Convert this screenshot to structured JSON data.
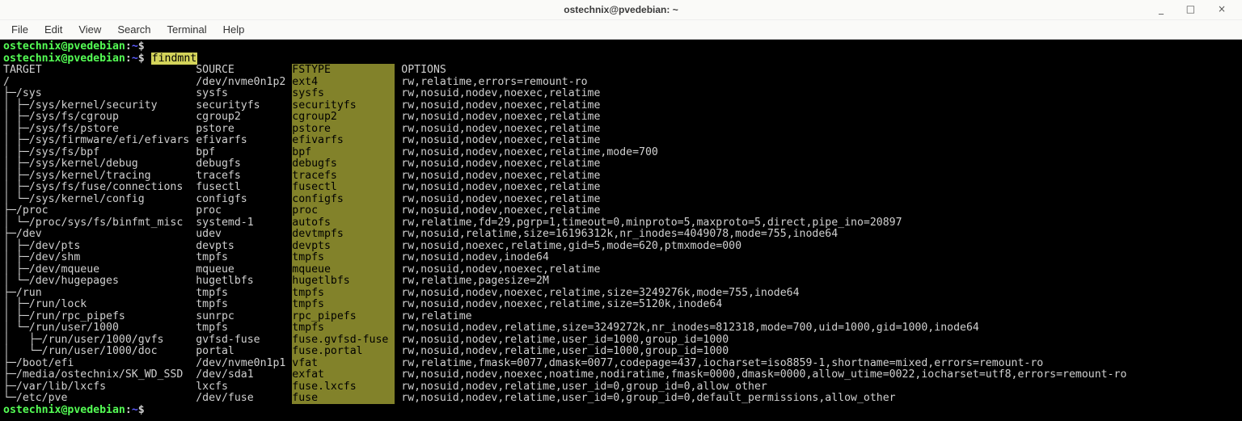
{
  "window": {
    "title": "ostechnix@pvedebian: ~"
  },
  "menubar": [
    "File",
    "Edit",
    "View",
    "Search",
    "Terminal",
    "Help"
  ],
  "prompts": {
    "user_host": "ostechnix@pvedebian",
    "colon": ":",
    "path": "~",
    "dollar": "$"
  },
  "command": "findmnt",
  "headers": {
    "target": "TARGET",
    "source": "SOURCE",
    "fstype": "FSTYPE",
    "options": "OPTIONS"
  },
  "rows": [
    {
      "depth": 0,
      "last": false,
      "target": "/",
      "source": "/dev/nvme0n1p2",
      "fstype": "ext4",
      "options": "rw,relatime,errors=remount-ro"
    },
    {
      "depth": 1,
      "ancestors": [
        false
      ],
      "last": false,
      "target": "/sys",
      "source": "sysfs",
      "fstype": "sysfs",
      "options": "rw,nosuid,nodev,noexec,relatime"
    },
    {
      "depth": 2,
      "ancestors": [
        false,
        false
      ],
      "last": false,
      "target": "/sys/kernel/security",
      "source": "securityfs",
      "fstype": "securityfs",
      "options": "rw,nosuid,nodev,noexec,relatime"
    },
    {
      "depth": 2,
      "ancestors": [
        false,
        false
      ],
      "last": false,
      "target": "/sys/fs/cgroup",
      "source": "cgroup2",
      "fstype": "cgroup2",
      "options": "rw,nosuid,nodev,noexec,relatime"
    },
    {
      "depth": 2,
      "ancestors": [
        false,
        false
      ],
      "last": false,
      "target": "/sys/fs/pstore",
      "source": "pstore",
      "fstype": "pstore",
      "options": "rw,nosuid,nodev,noexec,relatime"
    },
    {
      "depth": 2,
      "ancestors": [
        false,
        false
      ],
      "last": false,
      "target": "/sys/firmware/efi/efivars",
      "source": "efivarfs",
      "fstype": "efivarfs",
      "options": "rw,nosuid,nodev,noexec,relatime"
    },
    {
      "depth": 2,
      "ancestors": [
        false,
        false
      ],
      "last": false,
      "target": "/sys/fs/bpf",
      "source": "bpf",
      "fstype": "bpf",
      "options": "rw,nosuid,nodev,noexec,relatime,mode=700"
    },
    {
      "depth": 2,
      "ancestors": [
        false,
        false
      ],
      "last": false,
      "target": "/sys/kernel/debug",
      "source": "debugfs",
      "fstype": "debugfs",
      "options": "rw,nosuid,nodev,noexec,relatime"
    },
    {
      "depth": 2,
      "ancestors": [
        false,
        false
      ],
      "last": false,
      "target": "/sys/kernel/tracing",
      "source": "tracefs",
      "fstype": "tracefs",
      "options": "rw,nosuid,nodev,noexec,relatime"
    },
    {
      "depth": 2,
      "ancestors": [
        false,
        false
      ],
      "last": false,
      "target": "/sys/fs/fuse/connections",
      "source": "fusectl",
      "fstype": "fusectl",
      "options": "rw,nosuid,nodev,noexec,relatime"
    },
    {
      "depth": 2,
      "ancestors": [
        false,
        false
      ],
      "last": true,
      "target": "/sys/kernel/config",
      "source": "configfs",
      "fstype": "configfs",
      "options": "rw,nosuid,nodev,noexec,relatime"
    },
    {
      "depth": 1,
      "ancestors": [
        false
      ],
      "last": false,
      "target": "/proc",
      "source": "proc",
      "fstype": "proc",
      "options": "rw,nosuid,nodev,noexec,relatime"
    },
    {
      "depth": 2,
      "ancestors": [
        false,
        false
      ],
      "last": true,
      "target": "/proc/sys/fs/binfmt_misc",
      "source": "systemd-1",
      "fstype": "autofs",
      "options": "rw,relatime,fd=29,pgrp=1,timeout=0,minproto=5,maxproto=5,direct,pipe_ino=20897"
    },
    {
      "depth": 1,
      "ancestors": [
        false
      ],
      "last": false,
      "target": "/dev",
      "source": "udev",
      "fstype": "devtmpfs",
      "options": "rw,nosuid,relatime,size=16196312k,nr_inodes=4049078,mode=755,inode64"
    },
    {
      "depth": 2,
      "ancestors": [
        false,
        false
      ],
      "last": false,
      "target": "/dev/pts",
      "source": "devpts",
      "fstype": "devpts",
      "options": "rw,nosuid,noexec,relatime,gid=5,mode=620,ptmxmode=000"
    },
    {
      "depth": 2,
      "ancestors": [
        false,
        false
      ],
      "last": false,
      "target": "/dev/shm",
      "source": "tmpfs",
      "fstype": "tmpfs",
      "options": "rw,nosuid,nodev,inode64"
    },
    {
      "depth": 2,
      "ancestors": [
        false,
        false
      ],
      "last": false,
      "target": "/dev/mqueue",
      "source": "mqueue",
      "fstype": "mqueue",
      "options": "rw,nosuid,nodev,noexec,relatime"
    },
    {
      "depth": 2,
      "ancestors": [
        false,
        false
      ],
      "last": true,
      "target": "/dev/hugepages",
      "source": "hugetlbfs",
      "fstype": "hugetlbfs",
      "options": "rw,relatime,pagesize=2M"
    },
    {
      "depth": 1,
      "ancestors": [
        false
      ],
      "last": false,
      "target": "/run",
      "source": "tmpfs",
      "fstype": "tmpfs",
      "options": "rw,nosuid,nodev,noexec,relatime,size=3249276k,mode=755,inode64"
    },
    {
      "depth": 2,
      "ancestors": [
        false,
        false
      ],
      "last": false,
      "target": "/run/lock",
      "source": "tmpfs",
      "fstype": "tmpfs",
      "options": "rw,nosuid,nodev,noexec,relatime,size=5120k,inode64"
    },
    {
      "depth": 2,
      "ancestors": [
        false,
        false
      ],
      "last": false,
      "target": "/run/rpc_pipefs",
      "source": "sunrpc",
      "fstype": "rpc_pipefs",
      "options": "rw,relatime"
    },
    {
      "depth": 2,
      "ancestors": [
        false,
        false
      ],
      "last": true,
      "target": "/run/user/1000",
      "source": "tmpfs",
      "fstype": "tmpfs",
      "options": "rw,nosuid,nodev,relatime,size=3249272k,nr_inodes=812318,mode=700,uid=1000,gid=1000,inode64"
    },
    {
      "depth": 3,
      "ancestors": [
        false,
        false,
        true
      ],
      "last": false,
      "target": "/run/user/1000/gvfs",
      "source": "gvfsd-fuse",
      "fstype": "fuse.gvfsd-fuse",
      "options": "rw,nosuid,nodev,relatime,user_id=1000,group_id=1000"
    },
    {
      "depth": 3,
      "ancestors": [
        false,
        false,
        true
      ],
      "last": true,
      "target": "/run/user/1000/doc",
      "source": "portal",
      "fstype": "fuse.portal",
      "options": "rw,nosuid,nodev,relatime,user_id=1000,group_id=1000"
    },
    {
      "depth": 1,
      "ancestors": [
        false
      ],
      "last": false,
      "target": "/boot/efi",
      "source": "/dev/nvme0n1p1",
      "fstype": "vfat",
      "options": "rw,relatime,fmask=0077,dmask=0077,codepage=437,iocharset=iso8859-1,shortname=mixed,errors=remount-ro"
    },
    {
      "depth": 1,
      "ancestors": [
        false
      ],
      "last": false,
      "target": "/media/ostechnix/SK_WD_SSD",
      "source": "/dev/sda1",
      "fstype": "exfat",
      "options": "rw,nosuid,nodev,noexec,noatime,nodiratime,fmask=0000,dmask=0000,allow_utime=0022,iocharset=utf8,errors=remount-ro"
    },
    {
      "depth": 1,
      "ancestors": [
        false
      ],
      "last": false,
      "target": "/var/lib/lxcfs",
      "source": "lxcfs",
      "fstype": "fuse.lxcfs",
      "options": "rw,nosuid,nodev,relatime,user_id=0,group_id=0,allow_other"
    },
    {
      "depth": 1,
      "ancestors": [
        false
      ],
      "last": true,
      "target": "/etc/pve",
      "source": "/dev/fuse",
      "fstype": "fuse",
      "options": "rw,nosuid,nodev,relatime,user_id=0,group_id=0,default_permissions,allow_other"
    }
  ]
}
